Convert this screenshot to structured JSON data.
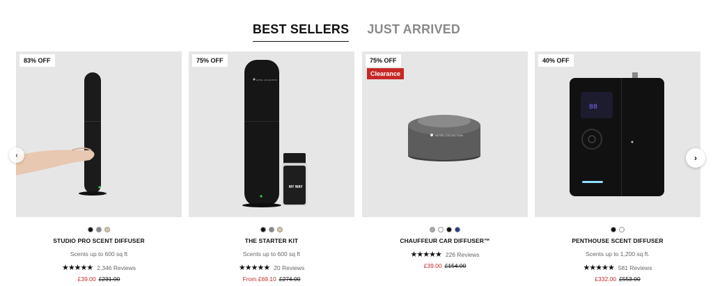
{
  "tabs": [
    {
      "label": "BEST SELLERS"
    },
    {
      "label": "JUST ARRIVED"
    }
  ],
  "products": [
    {
      "badge": "83% OFF",
      "name": "STUDIO PRO SCENT DIFFUSER",
      "sub": "Scents up to 600 sq ft",
      "stars": "★★★★★",
      "reviews": "2,346 Reviews",
      "price": "£39.00",
      "was": "£231.00",
      "swatches": [
        "#111111",
        "#888888",
        "#d8c6a4"
      ]
    },
    {
      "badge": "75% OFF",
      "name": "THE STARTER KIT",
      "sub": "Scents up to 600 sq ft",
      "stars": "★★★★★",
      "reviews": "20 Reviews",
      "price": "From £69.10",
      "was": "£274.00",
      "swatches": [
        "#111111",
        "#888888",
        "#d8c6a4"
      ]
    },
    {
      "badge": "75% OFF",
      "clearance": "Clearance",
      "name": "CHAUFFEUR CAR DIFFUSER™",
      "stars": "★★★★★",
      "reviews": "226 Reviews",
      "price": "£39.00",
      "was": "£154.00",
      "swatches": [
        "#aaaaaa",
        "#ffffff",
        "#111111",
        "#1f3a8a"
      ]
    },
    {
      "badge": "40% OFF",
      "name": "PENTHOUSE SCENT DIFFUSER",
      "sub": "Scents up to 1,200 sq ft.",
      "stars": "★★★★★",
      "reviews": "581 Reviews",
      "price": "£332.00",
      "was": "£553.00",
      "swatches": [
        "#111111",
        "#ffffff"
      ]
    }
  ],
  "nav": {
    "prev": "‹",
    "next": "›"
  },
  "product_text": {
    "brand": "HOTEL COLLECTION",
    "my_way": "MY WAY"
  },
  "colors": {
    "accent": "#c62828",
    "imageBg": "#e6e6e6"
  }
}
